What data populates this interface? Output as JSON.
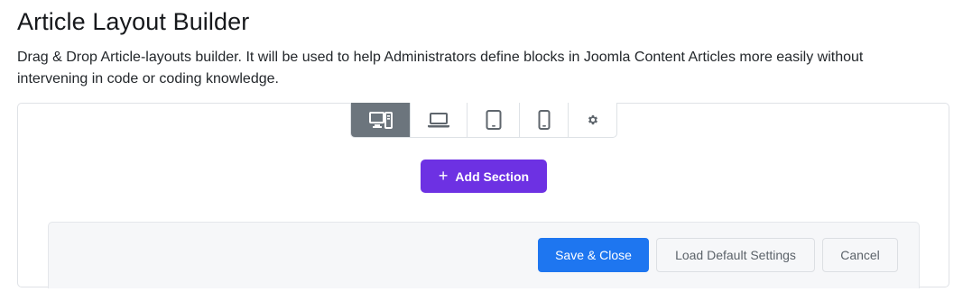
{
  "header": {
    "title": "Article Layout Builder",
    "description": "Drag & Drop Article-layouts builder. It will be used to help Administrators define blocks in Joomla Content Articles more easily without intervening in code or coding knowledge."
  },
  "device_toolbar": {
    "items": [
      {
        "icon": "desktop-icon",
        "active": true
      },
      {
        "icon": "laptop-icon",
        "active": false
      },
      {
        "icon": "tablet-icon",
        "active": false
      },
      {
        "icon": "mobile-icon",
        "active": false
      },
      {
        "icon": "gear-icon",
        "active": false
      }
    ]
  },
  "builder": {
    "add_section_label": "Add Section",
    "add_section_icon": "plus-icon",
    "accent_color": "#6d31e3"
  },
  "footer": {
    "save_label": "Save & Close",
    "load_default_label": "Load Default Settings",
    "cancel_label": "Cancel",
    "primary_color": "#1e76f0"
  }
}
